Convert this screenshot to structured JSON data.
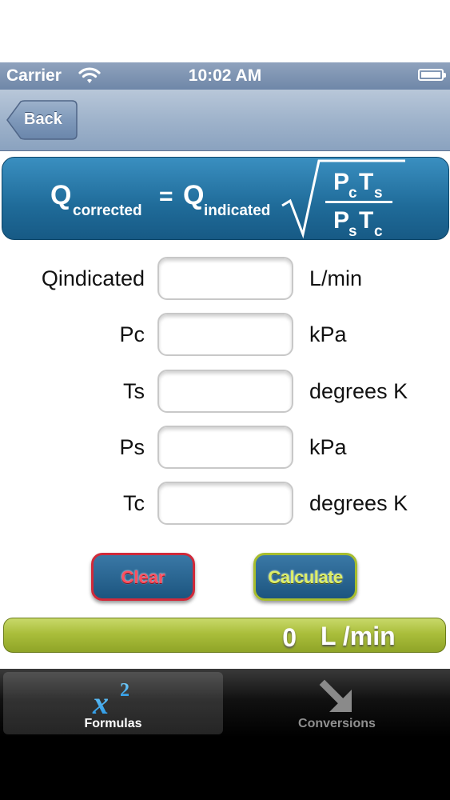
{
  "status_bar": {
    "carrier": "Carrier",
    "time": "10:02 AM"
  },
  "nav": {
    "back_label": "Back"
  },
  "formula": {
    "lhs": "Q",
    "lhs_sub": "corrected",
    "equals": "=",
    "rhs": "Q",
    "rhs_sub": "indicated",
    "num_p": "P",
    "num_p_sub": "c",
    "num_t": "T",
    "num_t_sub": "s",
    "den_p": "P",
    "den_p_sub": "s",
    "den_t": "T",
    "den_t_sub": "c"
  },
  "inputs": [
    {
      "label": "Qindicated",
      "value": "",
      "unit": "L/min"
    },
    {
      "label": "Pc",
      "value": "",
      "unit": "kPa"
    },
    {
      "label": "Ts",
      "value": "",
      "unit": "degrees K"
    },
    {
      "label": "Ps",
      "value": "",
      "unit": "kPa"
    },
    {
      "label": "Tc",
      "value": "",
      "unit": "degrees K"
    }
  ],
  "buttons": {
    "clear": "Clear",
    "calculate": "Calculate"
  },
  "result": {
    "value": "0",
    "unit": "L /min"
  },
  "tabs": [
    {
      "label": "Formulas",
      "icon": "x-squared-icon",
      "selected": true
    },
    {
      "label": "Conversions",
      "icon": "arrow-down-right-icon",
      "selected": false
    }
  ],
  "colors": {
    "accent_blue": "#1f6b99",
    "clear_border": "#d02a3a",
    "calc_border": "#a7bd2e",
    "result_green": "#aabe3b"
  }
}
